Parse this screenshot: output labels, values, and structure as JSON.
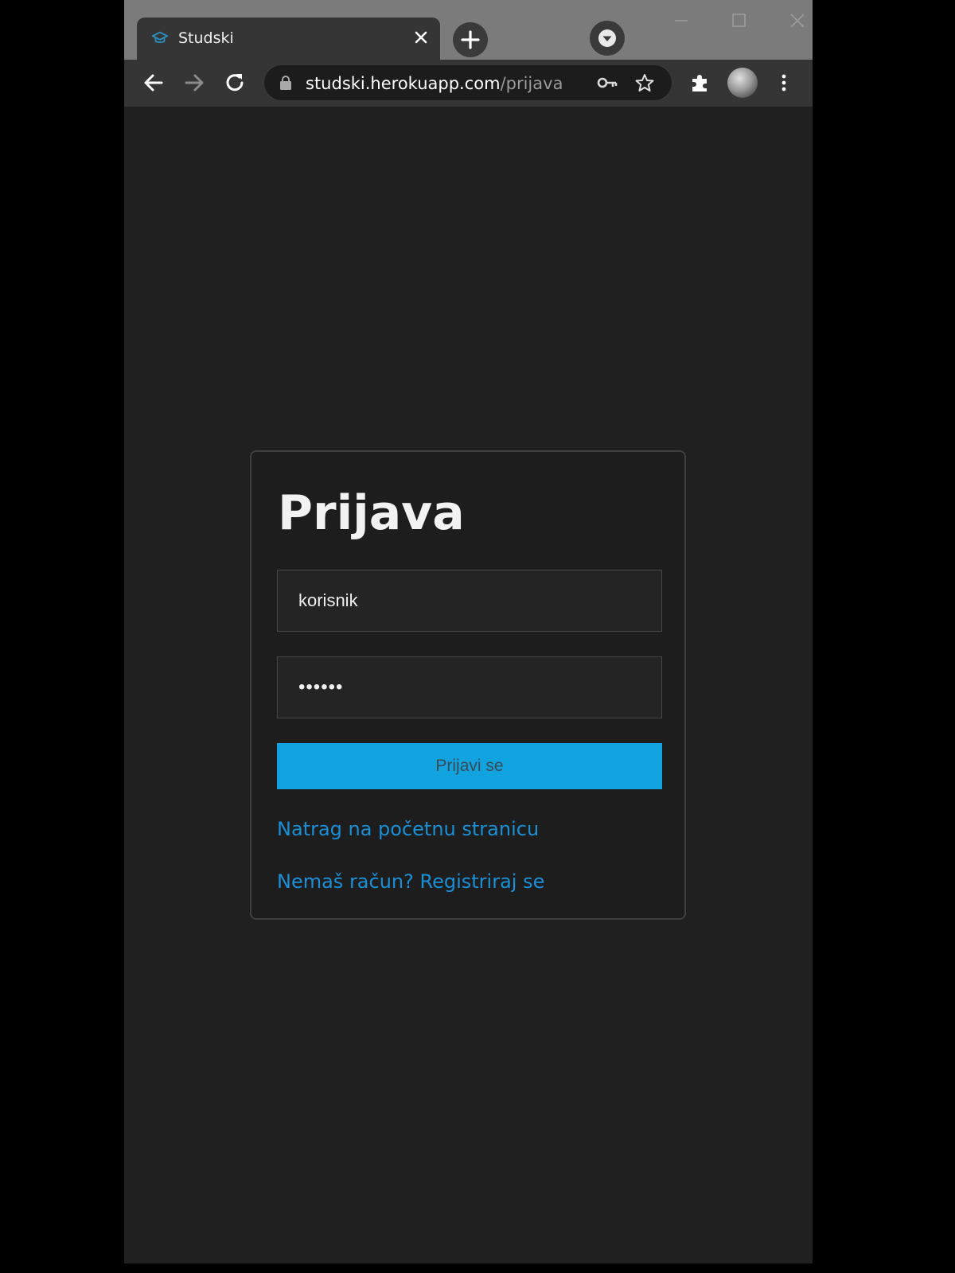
{
  "browser": {
    "tab": {
      "title": "Studski",
      "favicon": "graduation-cap-icon",
      "close_icon": "close-icon"
    },
    "url": {
      "host": "studski.herokuapp.com",
      "path": "/prijava"
    },
    "colors": {
      "tabstrip": "#7b7b7b",
      "toolbar": "#353535",
      "page_background": "#202020"
    }
  },
  "login": {
    "title": "Prijava",
    "username_value": "korisnik",
    "password_value": "••••••",
    "submit_label": "Prijavi se",
    "back_link": "Natrag na početnu stranicu",
    "register_link": "Nemaš račun? Registriraj se",
    "colors": {
      "button": "#10a3e0",
      "link": "#1a8fd6"
    }
  }
}
